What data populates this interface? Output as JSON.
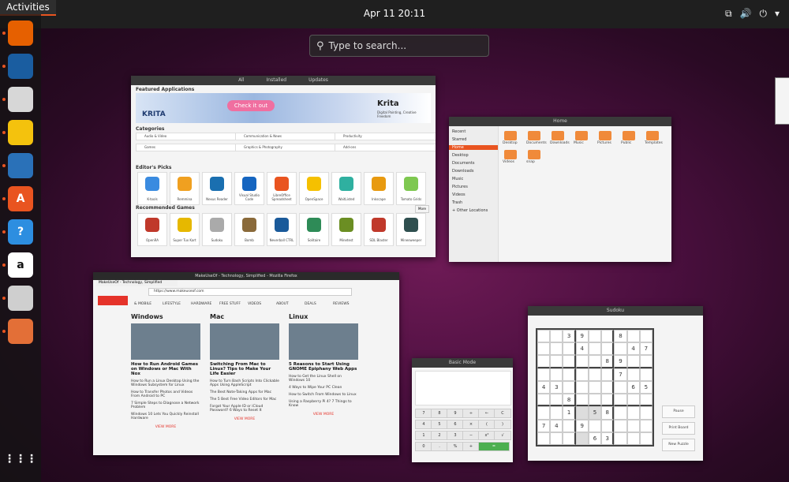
{
  "topbar": {
    "activities": "Activities",
    "clock": "Apr 11  20:11",
    "tray": {
      "network": "⧉",
      "volume": "🔊",
      "power": "⏻",
      "chevron": "▾"
    }
  },
  "search": {
    "placeholder": "Type to search..."
  },
  "dock": {
    "items": [
      {
        "name": "firefox",
        "glyph": "",
        "color": "#e66000"
      },
      {
        "name": "thunderbird",
        "glyph": "",
        "color": "#1a5da0"
      },
      {
        "name": "files",
        "glyph": "",
        "color": "#d7d7d7"
      },
      {
        "name": "rhythmbox",
        "glyph": "",
        "color": "#f4c20d"
      },
      {
        "name": "writer",
        "glyph": "",
        "color": "#2a71b8"
      },
      {
        "name": "software",
        "glyph": "A",
        "color": "#e95420"
      },
      {
        "name": "help",
        "glyph": "?",
        "color": "#2d8ee0"
      },
      {
        "name": "amazon",
        "glyph": "a",
        "color": "#ffffff"
      },
      {
        "name": "sudoku",
        "glyph": "",
        "color": "#cfcfcf"
      },
      {
        "name": "calculator",
        "glyph": "",
        "color": "#e36f37"
      },
      {
        "name": "show-apps",
        "glyph": "⋮⋮⋮",
        "color": "transparent"
      }
    ]
  },
  "software": {
    "tabs": [
      "All",
      "Installed",
      "Updates"
    ],
    "featured_title": "Featured Applications",
    "banner_cta": "Check it out",
    "banner_left": "KRITA",
    "banner_app": "Krita",
    "banner_sub": "Digital Painting, Creative Freedom",
    "categories_title": "Categories",
    "categories": [
      "Audio & Video",
      "Communication & News",
      "Productivity",
      "Games",
      "Graphics & Photography",
      "Add-ons"
    ],
    "picks_title": "Editor's Picks",
    "picks": [
      {
        "name": "K-tools",
        "color": "#3a8be0"
      },
      {
        "name": "Remmina",
        "color": "#f0a020"
      },
      {
        "name": "Nexus Reader",
        "color": "#1a6fb0"
      },
      {
        "name": "Visual Studio Code",
        "color": "#1565c0"
      },
      {
        "name": "LibreOffice Spreadsheet",
        "color": "#e95420"
      },
      {
        "name": "OpenSpace",
        "color": "#f5c000"
      },
      {
        "name": "WaitListed",
        "color": "#2fb0a0"
      },
      {
        "name": "Inkscape",
        "color": "#e89a10"
      },
      {
        "name": "Tomato Grids",
        "color": "#7ec850"
      }
    ],
    "games_title": "Recommended Games",
    "games_more": "More",
    "games": [
      {
        "name": "OpenRA",
        "color": "#c0392b"
      },
      {
        "name": "Super Tux Kart",
        "color": "#e6b800"
      },
      {
        "name": "Sudoku",
        "color": "#aaaaaa"
      },
      {
        "name": "Bomb",
        "color": "#8a6a3a"
      },
      {
        "name": "Neverball CTRL",
        "color": "#1a5a9a"
      },
      {
        "name": "Solitaire",
        "color": "#2e8b57"
      },
      {
        "name": "Minetest",
        "color": "#6b8e23"
      },
      {
        "name": "SDL Blaster",
        "color": "#c0392b"
      },
      {
        "name": "Minesweeper",
        "color": "#2f4f4f"
      }
    ]
  },
  "files": {
    "title": "Home",
    "sidebar": [
      "Recent",
      "Starred",
      "Home",
      "Desktop",
      "Documents",
      "Downloads",
      "Music",
      "Pictures",
      "Videos",
      "Trash",
      "+ Other Locations"
    ],
    "folders": [
      "Desktop",
      "Documents",
      "Downloads",
      "Music",
      "Pictures",
      "Public",
      "Templates",
      "Videos",
      "snap"
    ]
  },
  "browser": {
    "tab": "MakeUseOf - Technology, Simplified",
    "title": "MakeUseOf - Technology, Simplified - Mozilla Firefox",
    "url": "https://www.makeuseof.com",
    "nav": [
      "& MOBILE",
      "LIFESTYLE",
      "HARDWARE",
      "FREE STUFF",
      "VIDEOS",
      "ABOUT",
      "DEALS",
      "REVIEWS"
    ],
    "columns": [
      {
        "head": "Windows",
        "title": "How to Run Android Games on Windows or Mac With Nox",
        "items": [
          "How to Run a Linux Desktop Using the Windows Subsystem for Linux",
          "How to Transfer Photos and Videos From Android to PC",
          "7 Simple Steps to Diagnose a Network Problem",
          "Windows 10 Lets You Quickly Reinstall Hardware"
        ]
      },
      {
        "head": "Mac",
        "title": "Switching From Mac to Linux? Tips to Make Your Life Easier",
        "items": [
          "How to Turn Bash Scripts Into Clickable Apps Using AppleScript",
          "The Best Note-Taking Apps for Mac",
          "The 5 Best Free Video Editors for Mac",
          "Forgot Your Apple ID or iCloud Password? 6 Ways to Reset It"
        ]
      },
      {
        "head": "Linux",
        "title": "5 Reasons to Start Using GNOME Epiphany Web Apps",
        "items": [
          "How to Get the Linux Shell on Windows 10",
          "4 Ways to Wipe Your PC Clean",
          "How to Switch From Windows to Linux",
          "Using a Raspberry Pi 4? 7 Things to Know"
        ]
      }
    ],
    "view_more": "VIEW MORE"
  },
  "calculator": {
    "title": "Basic Mode",
    "keys": [
      "7",
      "8",
      "9",
      "÷",
      "←",
      "C",
      "4",
      "5",
      "6",
      "×",
      "(",
      ")",
      "1",
      "2",
      "3",
      "−",
      "x²",
      "√",
      "0",
      ".",
      "%",
      "+",
      "="
    ]
  },
  "sudoku_win": {
    "title": "Sudoku",
    "grid": [
      [
        "",
        "",
        "3",
        "9",
        "",
        "",
        "8",
        "",
        ""
      ],
      [
        "",
        "",
        "",
        "4",
        "",
        "",
        "",
        "4",
        "7"
      ],
      [
        "",
        "",
        "",
        "",
        "",
        "8",
        "9",
        "",
        ""
      ],
      [
        "",
        "",
        "",
        "",
        "",
        "",
        "7",
        "",
        ""
      ],
      [
        "4",
        "3",
        "",
        "",
        "",
        "",
        "",
        "6",
        "5"
      ],
      [
        "",
        "",
        "8",
        "",
        "",
        "",
        "",
        "",
        ""
      ],
      [
        "",
        "",
        "1",
        "",
        "5",
        "8",
        "",
        "",
        ""
      ],
      [
        "7",
        "4",
        "",
        "9",
        "",
        "",
        "",
        "",
        ""
      ],
      [
        "",
        "",
        "",
        "",
        "6",
        "3",
        "",
        "",
        ""
      ]
    ],
    "buttons": [
      "Pause",
      "Print Board",
      "New Puzzle"
    ]
  }
}
